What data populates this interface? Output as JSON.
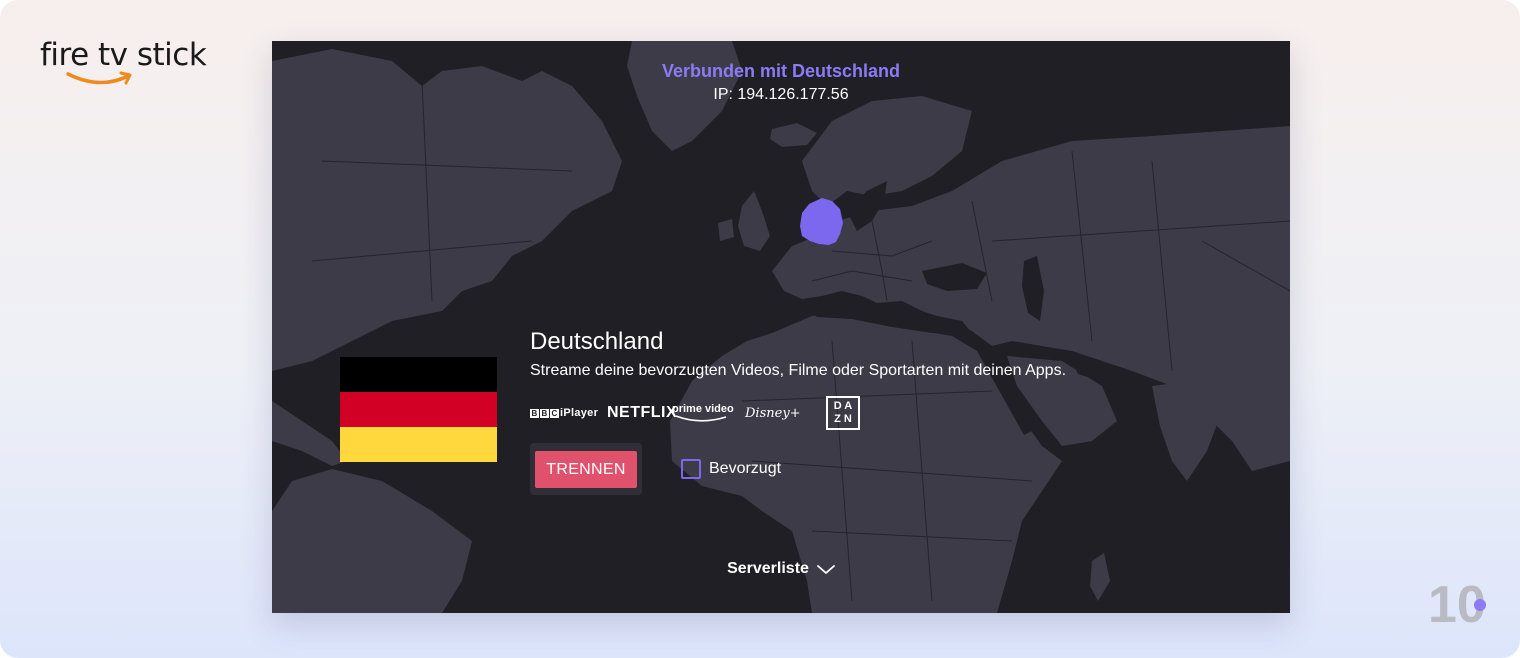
{
  "logo": {
    "text": "fire tv stick",
    "brand_color": "#f08a1c"
  },
  "status": {
    "title": "Verbunden mit Deutschland",
    "ip": "IP: 194.126.177.56",
    "accent": "#8c7bf5"
  },
  "location": {
    "country": "Deutschland",
    "description": "Streame deine bevorzugten Videos, Filme oder Sportarten mit deinen Apps.",
    "highlight_color": "#7b68ee"
  },
  "flag_colors": [
    "#000000",
    "#d10024",
    "#ffd83e"
  ],
  "apps": {
    "bbc_letters": [
      "B",
      "B",
      "C"
    ],
    "bbc_suffix": "iPlayer",
    "netflix": "NETFLIX",
    "prime": "prime video",
    "disney": "Disney+",
    "dazn_top": "D A",
    "dazn_bottom": "Z N"
  },
  "actions": {
    "disconnect": "TRENNEN",
    "favorite": "Bevorzugt",
    "favorite_checked": false,
    "disconnect_color": "#e0516c"
  },
  "footer": {
    "server_list": "Serverliste"
  },
  "watermark": {
    "text": "10"
  }
}
